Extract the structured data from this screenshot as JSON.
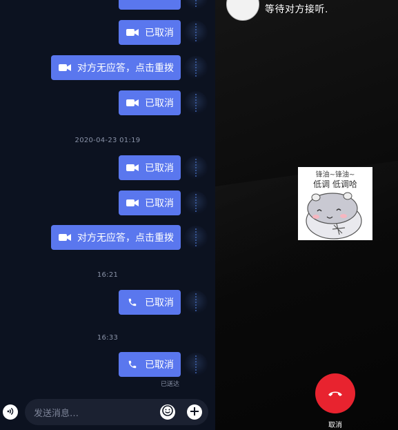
{
  "chat": {
    "messages": [
      {
        "icon": "video-camera-icon",
        "text": "已取消"
      },
      {
        "icon": "video-camera-icon",
        "text": "对方无应答，点击重拨"
      },
      {
        "icon": "video-camera-icon",
        "text": "已取消"
      },
      {
        "icon": "video-camera-icon",
        "text": "已取消"
      },
      {
        "icon": "video-camera-icon",
        "text": "已取消"
      },
      {
        "icon": "video-camera-icon",
        "text": "对方无应答，点击重拨"
      },
      {
        "icon": "phone-icon",
        "text": "已取消"
      },
      {
        "icon": "phone-icon",
        "text": "已取消"
      }
    ],
    "timestamps": [
      "2020-04-23 01:19",
      "16:21",
      "16:33"
    ],
    "delivered_status": "已送达",
    "input": {
      "placeholder": "发送消息…"
    }
  },
  "call": {
    "status": "等待对方接听.",
    "sticker": {
      "line1": "锋油~锋油~",
      "line2": "低调 低调哈"
    },
    "hangup_label": "取消"
  },
  "colors": {
    "chat_bg": "#0c1220",
    "bubble": "#5a77ee",
    "hangup": "#e8232f",
    "call_bg": "#0b0b0b"
  }
}
